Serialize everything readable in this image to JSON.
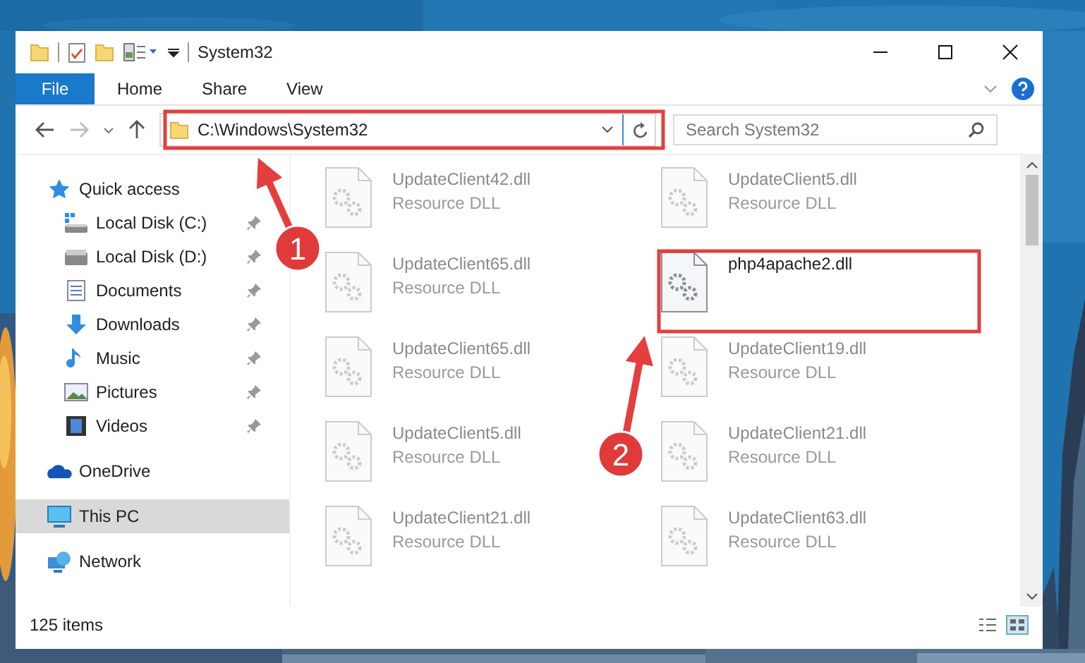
{
  "window": {
    "title": "System32"
  },
  "ribbon": {
    "file_menu": "File",
    "tabs": [
      {
        "label": "Home",
        "selected": false
      },
      {
        "label": "Share",
        "selected": false
      },
      {
        "label": "View",
        "selected": false
      }
    ]
  },
  "address": {
    "path": "C:\\Windows\\System32"
  },
  "search": {
    "placeholder": "Search System32"
  },
  "navigation": [
    {
      "name": "Quick access",
      "kind": "star",
      "selected": false,
      "children": [
        {
          "name": "Local Disk (C:)",
          "kind": "system-drive",
          "pinned": true,
          "selected": false
        },
        {
          "name": "Local Disk (D:)",
          "kind": "drive",
          "pinned": true,
          "selected": false
        },
        {
          "name": "Documents",
          "kind": "documents",
          "pinned": true,
          "selected": false
        },
        {
          "name": "Downloads",
          "kind": "downloads",
          "pinned": true,
          "selected": false
        },
        {
          "name": "Music",
          "kind": "music",
          "pinned": true,
          "selected": false
        },
        {
          "name": "Pictures",
          "kind": "pictures",
          "pinned": true,
          "selected": false
        },
        {
          "name": "Videos",
          "kind": "videos",
          "pinned": true,
          "selected": false
        }
      ]
    },
    {
      "name": "OneDrive",
      "kind": "cloud",
      "selected": false
    },
    {
      "name": "This PC",
      "kind": "pc",
      "selected": true
    },
    {
      "name": "Network",
      "kind": "network",
      "selected": false
    }
  ],
  "files": [
    {
      "name": "UpdateClient42.dll",
      "description": "Resource DLL",
      "blurred": true
    },
    {
      "name": "UpdateClient5.dll",
      "description": "Resource DLL",
      "blurred": true
    },
    {
      "name": "UpdateClient65.dll",
      "description": "Resource DLL",
      "blurred": true
    },
    {
      "name": "php4apache2.dll",
      "blurred": false
    },
    {
      "name": "UpdateClient65.dll",
      "description": "Resource DLL",
      "blurred": true
    },
    {
      "name": "UpdateClient19.dll",
      "description": "Resource DLL",
      "blurred": true
    },
    {
      "name": "UpdateClient5.dll",
      "description": "Resource DLL",
      "blurred": true
    },
    {
      "name": "UpdateClient21.dll",
      "description": "Resource DLL",
      "blurred": true
    },
    {
      "name": "UpdateClient21.dll",
      "description": "Resource DLL",
      "blurred": true
    },
    {
      "name": "UpdateClient63.dll",
      "description": "Resource DLL",
      "blurred": true
    }
  ],
  "status_bar": {
    "item_count": "125 items"
  },
  "annotations": [
    {
      "number": "1"
    },
    {
      "number": "2"
    }
  ]
}
